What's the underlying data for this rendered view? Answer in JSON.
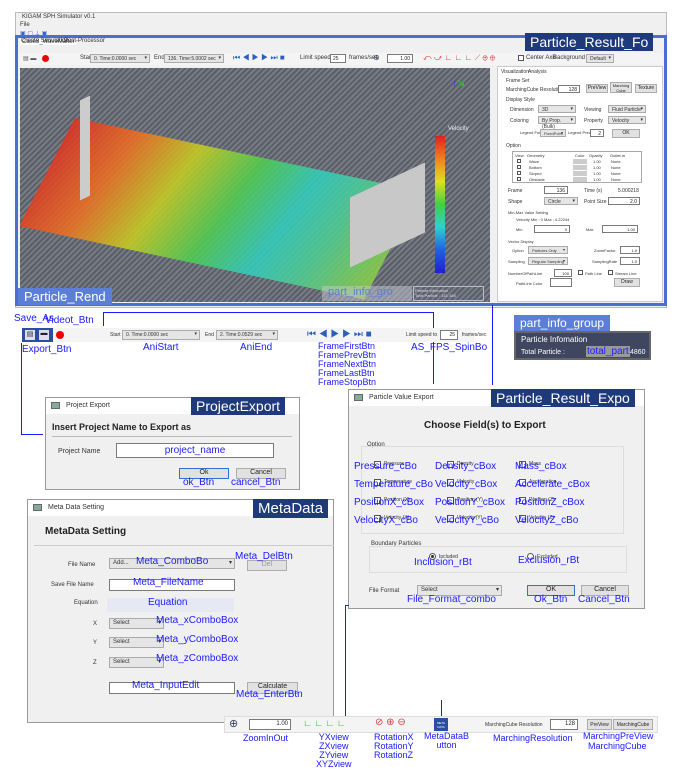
{
  "main": {
    "title": "KIGAM SPH Simulator v0.1",
    "menu": "File",
    "file_tab": "Case3_WaveMaker",
    "tabs": [
      "Create Simulation",
      "Post-Processor"
    ],
    "start_label": "Start",
    "start_value": "0. Time:0.0000 sec",
    "end_label": "End",
    "end_value": "136. Time:5.0002 sec",
    "limit_label": "Limit speed to",
    "fps": "25",
    "fps_unit": "frames/sec",
    "zoom": "1.00",
    "center_axis": "Center Axis",
    "bg_label": "Background Color",
    "bg_value": "Default",
    "legend_title": "Velocity",
    "part_info_title": "Particle Infomation",
    "part_info_total": "Total Particle :",
    "part_info_value": "141,168"
  },
  "right_panel": {
    "tabs": [
      "Visualization",
      "Analysis"
    ],
    "frame_set": "Frame Set",
    "mc_res_label": "MarchingCube Resolution",
    "mc_res": "128",
    "preview": "PreView",
    "marching_cube": "Marching Cube",
    "texture": "Texture",
    "display_style": "Display Style",
    "dimension_label": "Dimension",
    "dimension": "3D",
    "viewing_label": "Viewing",
    "viewing": "Fluid Particle",
    "coloring_label": "Coloring",
    "coloring": "By Prop. (Bulk)",
    "property_label": "Property",
    "property": "Velocity",
    "legend_format_label": "Legend Format",
    "legend_format": "FixedPoint",
    "legend_precision_label": "Legend Precision",
    "legend_precision": "2",
    "ok": "OK",
    "option": "Option",
    "table_headers": [
      "View",
      "Geometry",
      "Color",
      "Opacity",
      "Outlet.m"
    ],
    "rows": [
      {
        "name": "Wave",
        "opacity": "1.00",
        "outlet": "None"
      },
      {
        "name": "Bottom",
        "opacity": "1.00",
        "outlet": "None"
      },
      {
        "name": "Sloped",
        "opacity": "1.00",
        "outlet": "None"
      },
      {
        "name": "Obstacle",
        "opacity": "1.00",
        "outlet": "None"
      }
    ],
    "frame_label": "Frame",
    "frame": "136",
    "time_label": "Time (s)",
    "time": "5.000218",
    "shape_label": "Shape",
    "shape": "Circle",
    "point_size_label": "Point Size",
    "point_size": "2.0",
    "minmax_title": "Min-Max Value Setting",
    "minmax_text": "Velocity   Min : 0   Max : 4.22244",
    "min_label": "Min",
    "min": "0",
    "max_label": "Max",
    "max": "1.00",
    "vector_title": "Vector Display",
    "vopt_label": "Option",
    "vopt": "Particles Only",
    "zoom_factor_label": "ZoomFactor",
    "zoom_factor": "1.0",
    "sampling_label": "Sampling",
    "sampling": "Regular Sampling",
    "sampling_rate_label": "SamplingRate",
    "sampling_rate": "1.0",
    "pathline_num_label": "NumberOfPathLine",
    "pathline_num": "100",
    "pathline": "Path Line",
    "streamline": "Stream Line",
    "pathline_color": "PathLine Color",
    "draw": "Draw"
  },
  "toolbar": {
    "start_value": "0. Time:0.0000 sec",
    "end_value": "2. Time:0.0529 sec",
    "fps": "25",
    "start_label": "Start",
    "end_label": "End",
    "limit_label": "Limit speed to",
    "fps_unit": "frames/sec"
  },
  "part_info": {
    "title": "Particle Infomation",
    "total": "Total Particle :",
    "value": "4860"
  },
  "project_export": {
    "title": "Project Export",
    "heading": "Insert Project Name to Export as",
    "name_label": "Project Name",
    "ok": "Ok",
    "cancel": "Cancel"
  },
  "value_export": {
    "title": "Particle Value Export",
    "heading": "Choose Field(s) to Export",
    "option": "Option",
    "fields": [
      "Pressure",
      "Density",
      "Mass",
      "Temperature",
      "Velocity",
      "Acceleration",
      "Position (X)",
      "Position (Y)",
      "Position (Z)",
      "Velocity (X)",
      "Velocity (Y)",
      "Velocity (Z)"
    ],
    "boundary": "Boundary Particles",
    "included": "Included",
    "excluded": "Excluded",
    "file_format_label": "File Format",
    "file_format": "Select",
    "ok": "OK",
    "cancel": "Cancel"
  },
  "metadata": {
    "title": "Meta Data Setting",
    "heading": "MetaData Setting",
    "file_name_label": "File Name",
    "file_name": "Add...",
    "del": "Del",
    "save_label": "Save File Name",
    "equation_label": "Equation",
    "x": "X",
    "y": "Y",
    "z": "Z",
    "select": "Select",
    "calculate": "Calculate"
  },
  "bottom": {
    "zoom": "1.00",
    "mc_label": "MarchingCube Resolution",
    "mc_value": "128",
    "preview": "PreView",
    "marching_cube": "MarchingCube",
    "meta_icon": "META DATA"
  },
  "annotations": {
    "particle_result": "Particle_Result_Fo",
    "particle_rend": "Particle_Rend",
    "part_info_gro": "part_info_gro",
    "part_info_group": "part_info_group",
    "total_part": "total_part",
    "save_as": "Save_As",
    "video_btn": "Videot_Btn",
    "export_btn": "Export_Btn",
    "ani_start": "AniStart",
    "ani_end": "AniEnd",
    "frame_btns": [
      "FrameFirstBtn",
      "FramePrevBtn",
      "FrameNextBtn",
      "FrameLastBtn",
      "FrameStopBtn"
    ],
    "fps_spin": "AS_FPS_SpinBo",
    "project_export": "ProjectExport",
    "project_name": "project_name",
    "ok_btn": "ok_Btn",
    "cancel_btn": "cancel_Btn",
    "value_export": "Particle_Result_Expo",
    "cboxes": [
      "Pressure_cBo",
      "Density_cBox",
      "Mass_cBox",
      "Temperature_cBo",
      "Velocity_cBox",
      "Accelerate_cBox",
      "PositionX_cBox",
      "PositionY_cBox",
      "PositionZ_cBox",
      "VelocityX_cBo",
      "VelocityY_cBo",
      "VelocityZ_cBo"
    ],
    "inclusion": "Inclusion_rBt",
    "exclusion": "Exclusion_rBt",
    "file_format": "File_Format_combo",
    "ok": "Ok_Btn",
    "cancel": "Cancel_Btn",
    "metadata": "MetaData",
    "meta_combo": "Meta_ComboBo",
    "meta_del": "Meta_DelBtn",
    "meta_file": "Meta_FileName",
    "equation": "Equation",
    "meta_x": "Meta_xComboBox",
    "meta_y": "Meta_yComboBox",
    "meta_z": "Meta_zComboBox",
    "meta_input": "Meta_InputEdit",
    "meta_enter": "Meta_EnterBtn",
    "zoom": "ZoomInOut",
    "views": [
      "YXview",
      "ZXview",
      "ZYview",
      "XYZview"
    ],
    "rotations": [
      "RotationX",
      "RotationY",
      "RotationZ"
    ],
    "meta_button": [
      "MetaDataB",
      "utton"
    ],
    "mc_res": "MarchingResolution",
    "mc_preview": "MarchingPreView",
    "mc_cube": "MarchingCube"
  },
  "colors": {
    "annotation": "#1a1aff",
    "tag": "#1f3a7a",
    "frame": "#4a6fd0"
  }
}
